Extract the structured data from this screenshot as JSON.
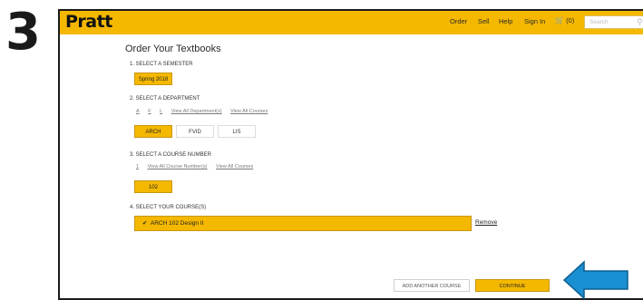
{
  "step_number": "3",
  "header": {
    "logo": "Pratt",
    "nav": [
      {
        "id": "order",
        "label": "Order"
      },
      {
        "id": "sell",
        "label": "Sell"
      },
      {
        "id": "help",
        "label": "Help"
      },
      {
        "id": "signin",
        "label": "Sign In"
      }
    ],
    "cart_count": "(0)",
    "search_placeholder": "Search"
  },
  "page_title": "Order Your Textbooks",
  "semester": {
    "label": "1. SELECT A SEMESTER",
    "selected": "Spring 2018"
  },
  "department": {
    "label": "2. SELECT A DEPARTMENT",
    "filters": [
      "A",
      "F",
      "L",
      "View All Department(s)",
      "View All Courses"
    ],
    "options": [
      {
        "label": "ARCH",
        "selected": true
      },
      {
        "label": "FVID",
        "selected": false
      },
      {
        "label": "LIS",
        "selected": false
      }
    ]
  },
  "course_number": {
    "label": "3. SELECT A COURSE NUMBER",
    "filters": [
      "1",
      "View All Course Number(s)",
      "View All Courses"
    ],
    "selected": "102"
  },
  "your_courses": {
    "label": "4. SELECT YOUR COURSE(S)",
    "course": "ARCH 102   Design II",
    "remove_label": "Remove"
  },
  "buttons": {
    "add_another": "ADD ANOTHER COURSE",
    "continue": "CONTINUE"
  },
  "colors": {
    "brand": "#f5b800",
    "arrow": "#1a8fd1"
  }
}
